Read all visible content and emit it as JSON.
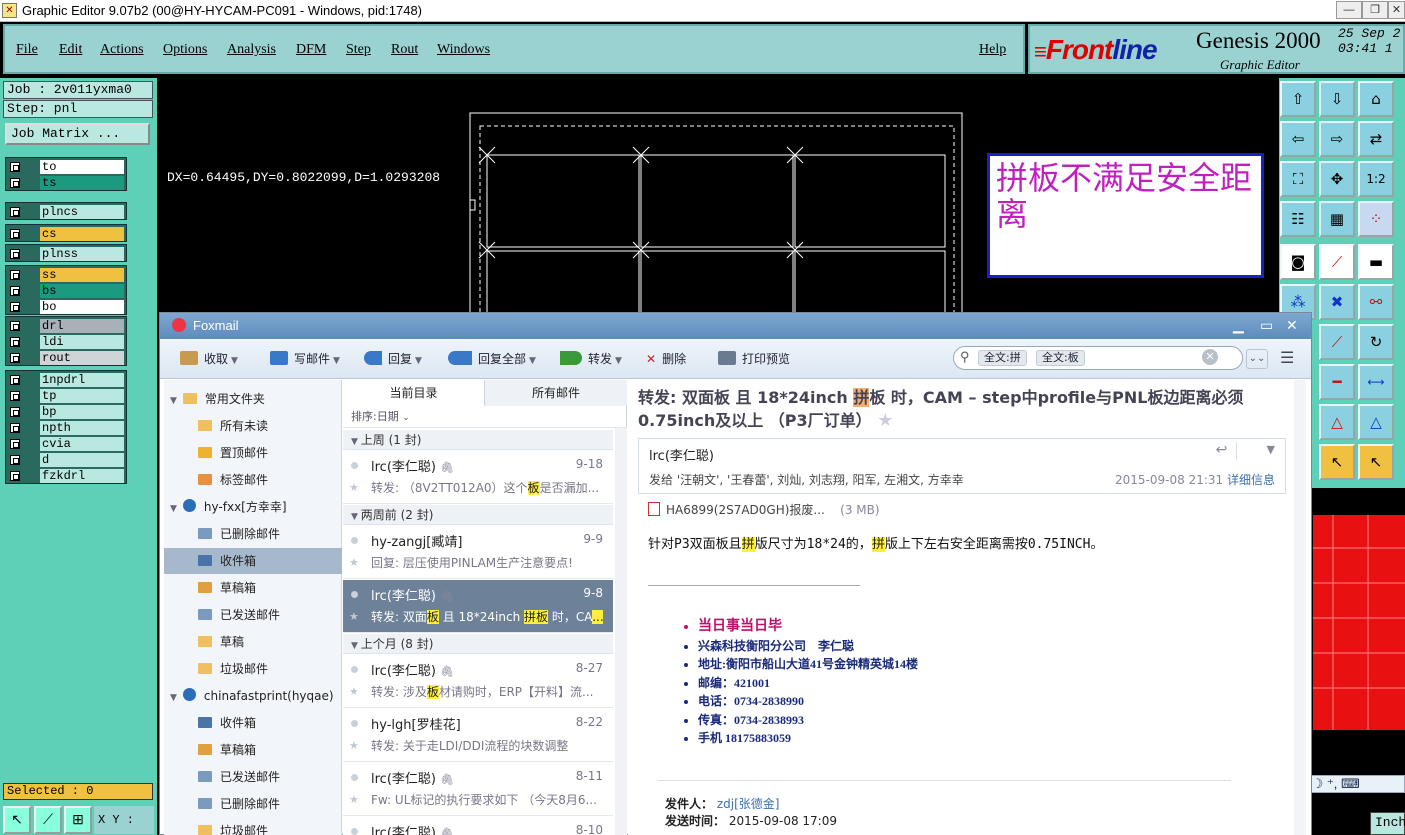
{
  "window": {
    "title": "Graphic Editor 9.07b2 (00@HY-HYCAM-PC091 - Windows, pid:1748)"
  },
  "menubar": {
    "items": [
      "File",
      "Edit",
      "Actions",
      "Options",
      "Analysis",
      "DFM",
      "Step",
      "Rout",
      "Windows"
    ],
    "help": "Help"
  },
  "brand": {
    "logo_front": "Front",
    "logo_line": "line",
    "product": "Genesis 2000",
    "subtitle": "Graphic Editor",
    "date_line1": "25 Sep 2",
    "date_line2": "03:41 1"
  },
  "left_panel": {
    "job": "Job : 2v011yxma0",
    "step": "Step: pnl",
    "job_matrix": "Job Matrix ...",
    "layer_groups": [
      [
        {
          "name": "to",
          "color": "#ffffff"
        },
        {
          "name": "ts",
          "color": "#1a9a7e"
        }
      ],
      [
        {
          "name": "plncs",
          "color": "#b8e8e0"
        }
      ],
      [
        {
          "name": "cs",
          "color": "#f0c040"
        }
      ],
      [
        {
          "name": "plnss",
          "color": "#b8e8e0"
        }
      ],
      [
        {
          "name": "ss",
          "color": "#f0c040"
        },
        {
          "name": "bs",
          "color": "#1a9a7e"
        },
        {
          "name": "bo",
          "color": "#ffffff"
        }
      ],
      [
        {
          "name": "drl",
          "color": "#a8b0b8"
        },
        {
          "name": "ldi",
          "color": "#b8e8e0"
        },
        {
          "name": "rout",
          "color": "#d0d4d8"
        }
      ],
      [
        {
          "name": "1npdrl",
          "color": "#b8e8e0"
        },
        {
          "name": "tp",
          "color": "#b8e8e0"
        },
        {
          "name": "bp",
          "color": "#b8e8e0"
        },
        {
          "name": "npth",
          "color": "#b8e8e0"
        },
        {
          "name": "cvia",
          "color": "#b8e8e0"
        },
        {
          "name": "d",
          "color": "#b8e8e0"
        },
        {
          "name": "fzkdrl",
          "color": "#b8e8e0"
        }
      ]
    ],
    "selected": "Selected : 0",
    "xy_label": "X Y :"
  },
  "canvas": {
    "measure": "DX=0.64495,DY=0.8022099,D=1.0293208",
    "note": "拼板不满足安全距离"
  },
  "right_panel": {
    "units": "Inch",
    "ime": "五 ☽ ⁺, ⌨"
  },
  "foxmail": {
    "title": "Foxmail",
    "toolbar": {
      "receive": "收取",
      "compose": "写邮件",
      "reply": "回复",
      "reply_all": "回复全部",
      "forward": "转发",
      "delete": "删除",
      "print_preview": "打印预览"
    },
    "search": {
      "chip1": "全文:拼",
      "chip2": "全文:板"
    },
    "tree": [
      {
        "label": "常用文件夹",
        "level": 0,
        "arrow": "▼",
        "icon": "folder",
        "color": "#f0c060"
      },
      {
        "label": "所有未读",
        "level": 1,
        "icon": "folder",
        "color": "#f0c060"
      },
      {
        "label": "置顶邮件",
        "level": 1,
        "icon": "star",
        "color": "#f0b030"
      },
      {
        "label": "标签邮件",
        "level": 1,
        "icon": "tag",
        "color": "#e89040"
      },
      {
        "label": "hy-fxx[方幸幸]",
        "level": 0,
        "arrow": "▼",
        "icon": "account",
        "color": "#2a6db8"
      },
      {
        "label": "已删除邮件",
        "level": 1,
        "icon": "trash",
        "color": "#7a9ac0"
      },
      {
        "label": "收件箱",
        "level": 1,
        "icon": "inbox",
        "color": "#4a74a8",
        "selected": true
      },
      {
        "label": "草稿箱",
        "level": 1,
        "icon": "draft",
        "color": "#e0a040"
      },
      {
        "label": "已发送邮件",
        "level": 1,
        "icon": "sent",
        "color": "#7a9ac0"
      },
      {
        "label": "草稿",
        "level": 1,
        "icon": "folder",
        "color": "#f0c060"
      },
      {
        "label": "垃圾邮件",
        "level": 1,
        "icon": "folder",
        "color": "#f0c060"
      },
      {
        "label": "chinafastprint(hyqae)",
        "level": 0,
        "arrow": "▼",
        "icon": "account",
        "color": "#2a6db8"
      },
      {
        "label": "收件箱",
        "level": 1,
        "icon": "inbox",
        "color": "#4a74a8"
      },
      {
        "label": "草稿箱",
        "level": 1,
        "icon": "draft",
        "color": "#e0a040"
      },
      {
        "label": "已发送邮件",
        "level": 1,
        "icon": "sent",
        "color": "#7a9ac0"
      },
      {
        "label": "已删除邮件",
        "level": 1,
        "icon": "trash",
        "color": "#7a9ac0"
      },
      {
        "label": "垃圾邮件",
        "level": 1,
        "icon": "folder",
        "color": "#f0c060"
      }
    ],
    "list": {
      "tab_current": "当前目录",
      "tab_all": "所有邮件",
      "sort": "排序:日期",
      "groups": [
        {
          "label": "上周 (1 封)",
          "messages": [
            {
              "from": "lrc(李仁聪)",
              "date": "9-18",
              "clip": true,
              "prev": [
                "转发: （8V2TT012A0）这个",
                "板",
                "是否漏加..."
              ]
            }
          ]
        },
        {
          "label": "两周前 (2 封)",
          "messages": [
            {
              "from": "hy-zangj[臧靖]",
              "date": "9-9",
              "clip": false,
              "prev": [
                "回复: 层压使用PINLAM生产注意要点!",
                "",
                ""
              ]
            },
            {
              "from": "lrc(李仁聪)",
              "date": "9-8",
              "clip": true,
              "selected": true,
              "prev": [
                "转发: 双面",
                "板",
                " 且 18*24inch ",
                "拼板",
                " 时，CA",
                "..."
              ]
            }
          ]
        },
        {
          "label": "上个月 (8 封)",
          "messages": [
            {
              "from": "lrc(李仁聪)",
              "date": "8-27",
              "clip": true,
              "prev": [
                "转发: 涉及",
                "板",
                "材请购时，ERP【开料】流..."
              ]
            },
            {
              "from": "hy-lgh[罗桂花]",
              "date": "8-22",
              "clip": false,
              "prev": [
                "转发: 关于走LDI/DDI流程的块数调整",
                "",
                ""
              ]
            },
            {
              "from": "lrc(李仁聪)",
              "date": "8-11",
              "clip": true,
              "prev": [
                "Fw: UL标记的执行要求如下 （今天8月6...",
                "",
                ""
              ]
            },
            {
              "from": "lrc(李仁聪)",
              "date": "8-10",
              "clip": true,
              "prev": [
                "",
                "",
                ""
              ]
            }
          ]
        }
      ]
    },
    "read": {
      "subject_a": "转发: 双面板 且 18*24inch ",
      "subject_hl": "拼",
      "subject_b": "板 时，CAM – step中profile与PNL板边距离必须0.75inch及以上 （P3厂订单）",
      "sender": "lrc(李仁聪)",
      "to": "发给 '汪朝文', '王春蕾', 刘灿, 刘志翔, 阳军, 左湘文, 方幸幸",
      "time": "2015-09-08 21:31",
      "details": "详细信息",
      "attachment": "HA6899(2S7AD0GH)报废...",
      "attachment_size": "(3 MB)",
      "body_a": "针对P3双面板且",
      "body_hl1": "拼",
      "body_b": "版尺寸为18*24的，",
      "body_hl2": "拼",
      "body_c": "版上下左右安全距离需按0.75INCH。",
      "sig": [
        "当日事当日毕",
        "兴森科技衡阳分公司　李仁聪",
        "地址:衡阳市船山大道41号金钟精英城14楼",
        "邮编：421001",
        "电话：0734-2838990",
        "传真：0734-2838993",
        "手机 18175883059"
      ],
      "fwd_from_label": "发件人：",
      "fwd_from": "zdj[张德金]",
      "fwd_time_label": "发送时间：",
      "fwd_time": "2015-09-08 17:09"
    }
  }
}
